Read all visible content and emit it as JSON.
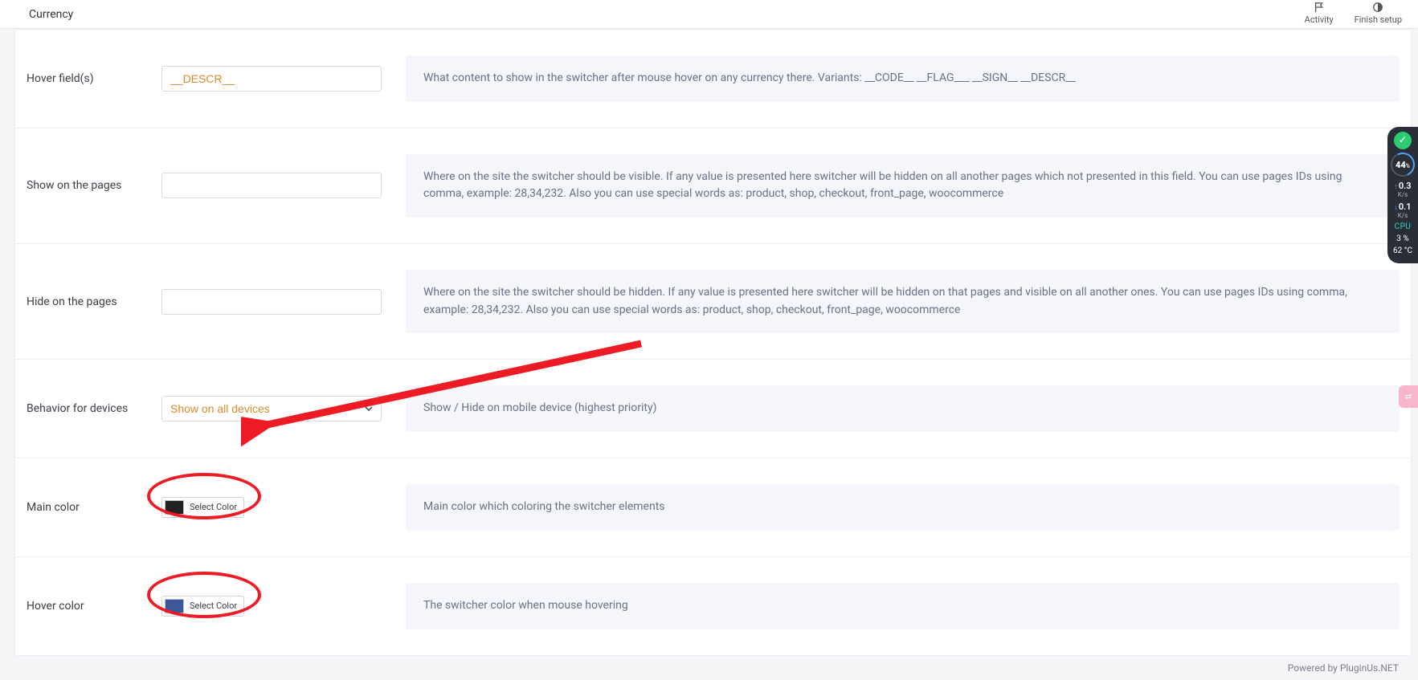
{
  "topbar": {
    "title": "Currency",
    "activity_label": "Activity",
    "finish_label": "Finish setup"
  },
  "rows": {
    "hover_fields": {
      "label": "Hover field(s)",
      "value": "__DESCR__",
      "desc": "What content to show in the switcher after mouse hover on any currency there. Variants: __CODE__ __FLAG___ __SIGN__ __DESCR__"
    },
    "show_pages": {
      "label": "Show on the pages",
      "value": "",
      "desc": "Where on the site the switcher should be visible. If any value is presented here switcher will be hidden on all another pages which not presented in this field. You can use pages IDs using comma, example: 28,34,232. Also you can use special words as: product, shop, checkout, front_page, woocommerce"
    },
    "hide_pages": {
      "label": "Hide on the pages",
      "value": "",
      "desc": "Where on the site the switcher should be hidden. If any value is presented here switcher will be hidden on that pages and visible on all another ones. You can use pages IDs using comma, example: 28,34,232. Also you can use special words as: product, shop, checkout, front_page, woocommerce"
    },
    "behavior": {
      "label": "Behavior for devices",
      "selected": "Show on all devices",
      "desc": "Show / Hide on mobile device (highest priority)"
    },
    "main_color": {
      "label": "Main color",
      "button": "Select Color",
      "swatch": "#222222",
      "desc": "Main color which coloring the switcher elements"
    },
    "hover_color": {
      "label": "Hover color",
      "button": "Select Color",
      "swatch": "#3b5998",
      "desc": "The switcher color when mouse hovering"
    }
  },
  "footer": {
    "text": "Powered by PluginUs.NET"
  },
  "sysmon": {
    "pct": "44",
    "pct_suffix": "%",
    "up": "0.3",
    "up_unit": "K/s",
    "down": "0.1",
    "down_unit": "K/s",
    "cpu_label": "CPU",
    "cpu_pct": "3  %",
    "temp": "62 °C"
  }
}
